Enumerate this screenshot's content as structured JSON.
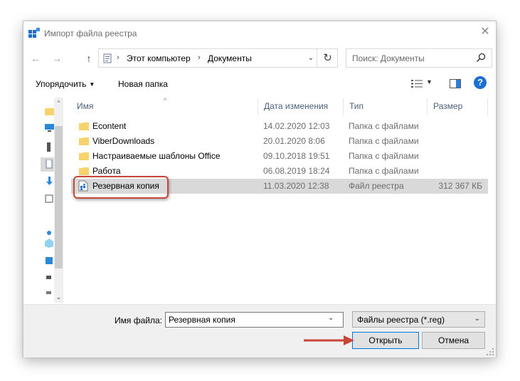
{
  "window": {
    "title": "Импорт файла реестра",
    "close_symbol": "✕"
  },
  "nav": {
    "back_symbol": "←",
    "forward_symbol": "→",
    "up_symbol": "↑",
    "breadcrumb": [
      "Этот компьютер",
      "Документы"
    ],
    "crumb_separator": "›",
    "dropdown_symbol": "⌄",
    "refresh_symbol": "↻"
  },
  "search": {
    "placeholder": "Поиск: Документы"
  },
  "toolbar": {
    "organize_label": "Упорядочить",
    "organize_caret": "▼",
    "new_folder_label": "Новая папка",
    "view_caret": "▼",
    "help_symbol": "?"
  },
  "columns": {
    "name": "Имя",
    "date": "Дата изменения",
    "type": "Тип",
    "size": "Размер",
    "sort_caret": "^"
  },
  "files": [
    {
      "name": "Econtent",
      "date": "14.02.2020 12:03",
      "type": "Папка с файлами",
      "size": "",
      "kind": "folder"
    },
    {
      "name": "ViberDownloads",
      "date": "20.01.2020 8:06",
      "type": "Папка с файлами",
      "size": "",
      "kind": "folder"
    },
    {
      "name": "Настраиваемые шаблоны Office",
      "date": "09.10.2018 19:51",
      "type": "Папка с файлами",
      "size": "",
      "kind": "folder"
    },
    {
      "name": "Работа",
      "date": "06.08.2019 18:24",
      "type": "Папка с файлами",
      "size": "",
      "kind": "folder"
    },
    {
      "name": "Резервная копия",
      "date": "11.03.2020 12:38",
      "type": "Файл реестра",
      "size": "312 367 КБ",
      "kind": "reg"
    }
  ],
  "sidebar": {
    "scroll_up_symbol": "^",
    "scroll_down_symbol": "⌄"
  },
  "footer": {
    "filename_label": "Имя файла:",
    "filename_value": "Резервная копия",
    "filename_dd_symbol": "⌄",
    "filter_label": "Файлы реестра (*.reg)",
    "filter_dd_symbol": "⌄",
    "open_label": "Открыть",
    "cancel_label": "Отмена"
  },
  "colors": {
    "accent": "#1a6fd6",
    "highlight": "#c8453a",
    "selection": "#d9d9d9",
    "folder": "#f7d36b"
  }
}
